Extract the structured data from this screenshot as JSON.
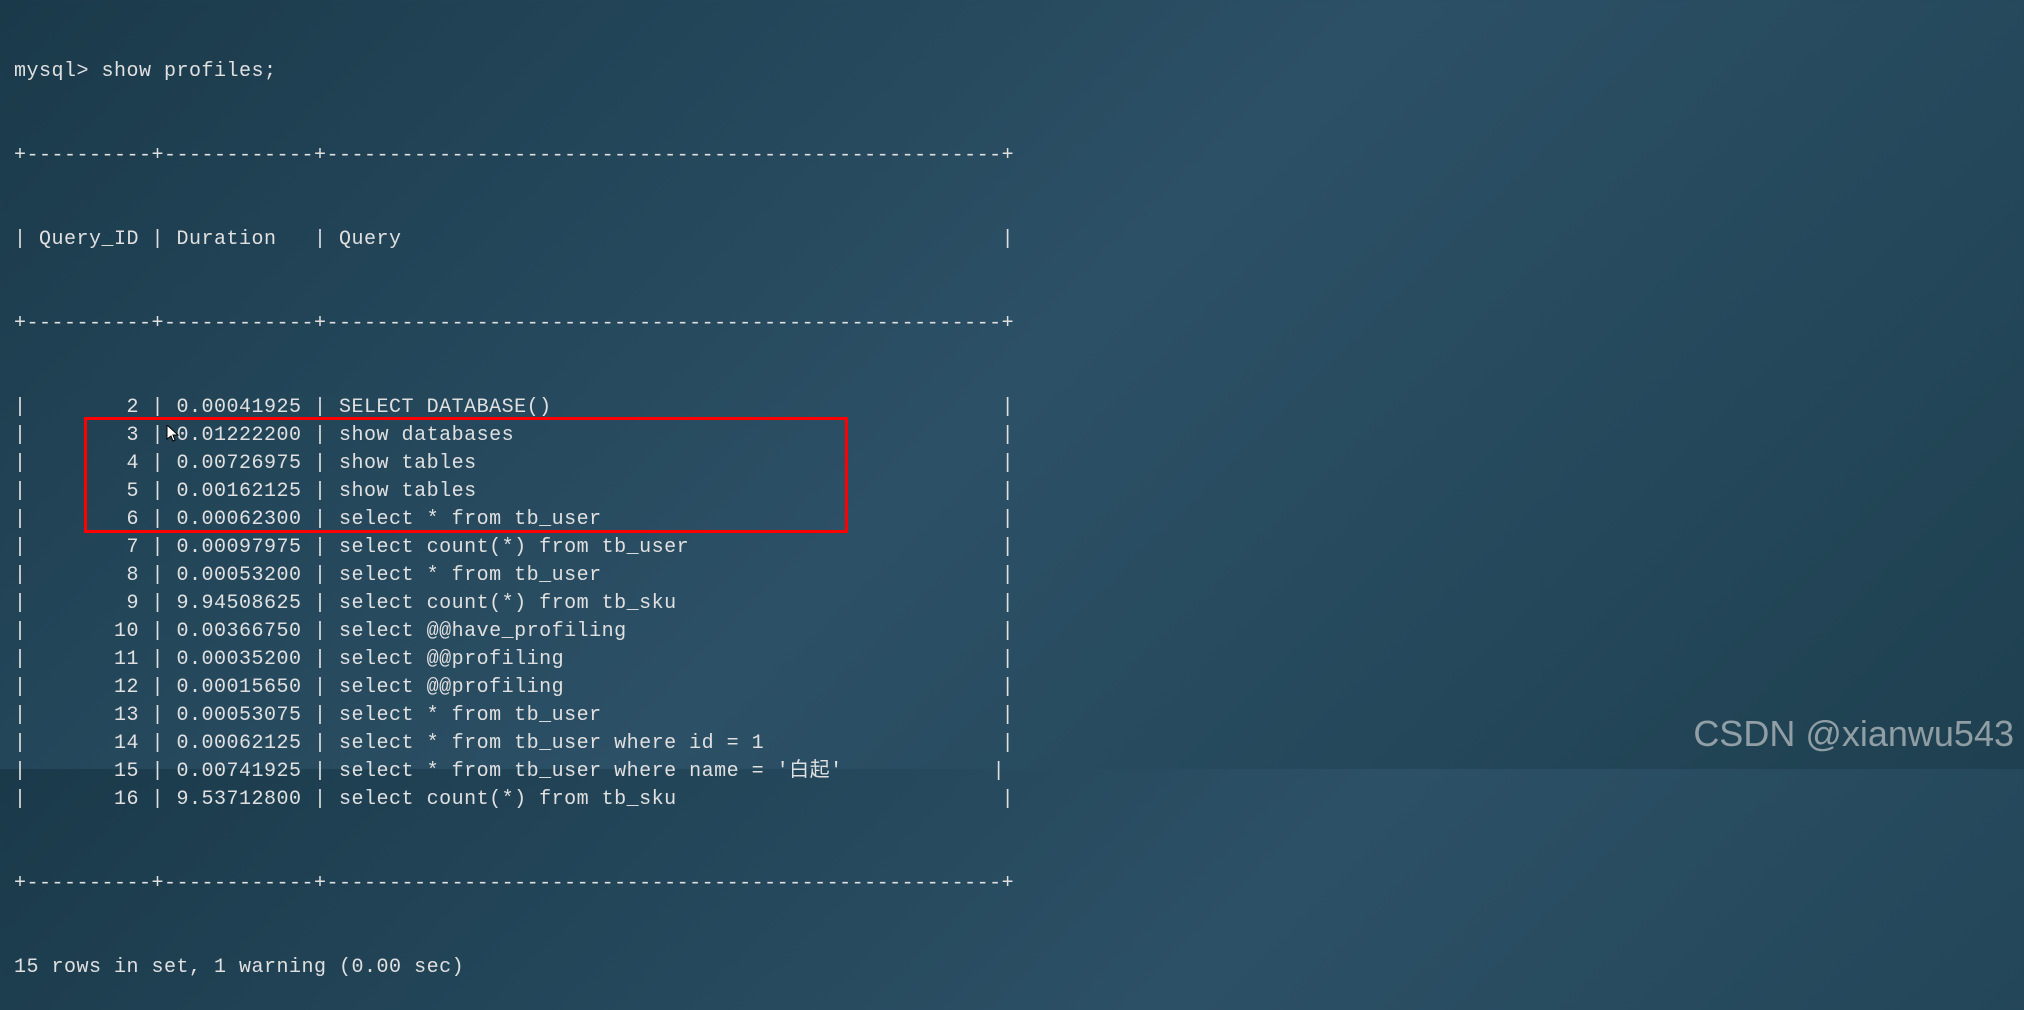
{
  "prompt": "mysql> show profiles;",
  "divider": "+----------+------------+------------------------------------------------------+",
  "header": "| Query_ID | Duration   | Query                                                |",
  "rows": [
    {
      "id": "2",
      "duration": "0.00041925",
      "query": "SELECT DATABASE()"
    },
    {
      "id": "3",
      "duration": "0.01222200",
      "query": "show databases"
    },
    {
      "id": "4",
      "duration": "0.00726975",
      "query": "show tables"
    },
    {
      "id": "5",
      "duration": "0.00162125",
      "query": "show tables"
    },
    {
      "id": "6",
      "duration": "0.00062300",
      "query": "select * from tb_user"
    },
    {
      "id": "7",
      "duration": "0.00097975",
      "query": "select count(*) from tb_user"
    },
    {
      "id": "8",
      "duration": "0.00053200",
      "query": "select * from tb_user"
    },
    {
      "id": "9",
      "duration": "9.94508625",
      "query": "select count(*) from tb_sku"
    },
    {
      "id": "10",
      "duration": "0.00366750",
      "query": "select @@have_profiling"
    },
    {
      "id": "11",
      "duration": "0.00035200",
      "query": "select @@profiling"
    },
    {
      "id": "12",
      "duration": "0.00015650",
      "query": "select @@profiling"
    },
    {
      "id": "13",
      "duration": "0.00053075",
      "query": "select * from tb_user"
    },
    {
      "id": "14",
      "duration": "0.00062125",
      "query": "select * from tb_user where id = 1"
    },
    {
      "id": "15",
      "duration": "0.00741925",
      "query": "select * from tb_user where name = '白起'"
    },
    {
      "id": "16",
      "duration": "9.53712800",
      "query": "select count(*) from tb_sku"
    }
  ],
  "footer": "15 rows in set, 1 warning (0.00 sec)",
  "watermark": "CSDN @xianwu543",
  "chart_data": {
    "type": "table",
    "title": "MySQL show profiles output",
    "columns": [
      "Query_ID",
      "Duration",
      "Query"
    ],
    "rows": [
      [
        2,
        0.00041925,
        "SELECT DATABASE()"
      ],
      [
        3,
        0.012222,
        "show databases"
      ],
      [
        4,
        0.00726975,
        "show tables"
      ],
      [
        5,
        0.00162125,
        "show tables"
      ],
      [
        6,
        0.000623,
        "select * from tb_user"
      ],
      [
        7,
        0.00097975,
        "select count(*) from tb_user"
      ],
      [
        8,
        0.000532,
        "select * from tb_user"
      ],
      [
        9,
        9.94508625,
        "select count(*) from tb_sku"
      ],
      [
        10,
        0.0036675,
        "select @@have_profiling"
      ],
      [
        11,
        0.000352,
        "select @@profiling"
      ],
      [
        12,
        0.0001565,
        "select @@profiling"
      ],
      [
        13,
        0.00053075,
        "select * from tb_user"
      ],
      [
        14,
        0.00062125,
        "select * from tb_user where id = 1"
      ],
      [
        15,
        0.00741925,
        "select * from tb_user where name = '白起'"
      ],
      [
        16,
        9.537128,
        "select count(*) from tb_sku"
      ]
    ]
  }
}
